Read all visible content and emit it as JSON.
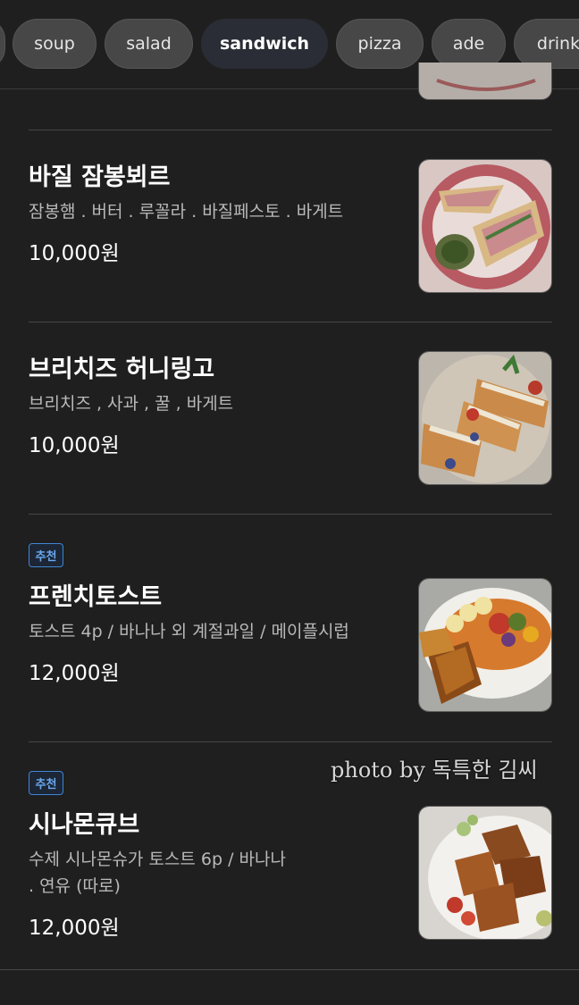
{
  "categories": [
    {
      "label": ""
    },
    {
      "label": "soup"
    },
    {
      "label": "salad"
    },
    {
      "label": "sandwich",
      "active": true
    },
    {
      "label": "pizza"
    },
    {
      "label": "ade"
    },
    {
      "label": "drink"
    }
  ],
  "menu_items": [
    {
      "name": "바질 잠봉뵈르",
      "description": "잠봉햄 . 버터 . 루꼴라 . 바질페스토 . 바게트",
      "price": "10,000원",
      "image": "basil-jambon-sandwich-photo"
    },
    {
      "name": "브리치즈 허니링고",
      "description": "브리치즈 , 사과 , 꿀 , 바게트",
      "price": "10,000원",
      "image": "brie-honey-apple-sandwich-photo"
    },
    {
      "badge": "추천",
      "name": "프렌치토스트",
      "description": "토스트 4p / 바나나 외 계절과일 / 메이플시럽",
      "price": "12,000원",
      "image": "french-toast-photo"
    },
    {
      "badge": "추천",
      "name": "시나몬큐브",
      "description": "수제 시나몬슈가 토스트 6p / 바나나 . 연유 (따로)",
      "price": "12,000원",
      "image": "cinnamon-cube-photo"
    }
  ],
  "watermark": "photo by 독특한 김씨",
  "colors": {
    "background": "#1f1f1f",
    "tab": "#474747",
    "tab_active": "#2a2d35",
    "badge": "#3f86d8"
  }
}
